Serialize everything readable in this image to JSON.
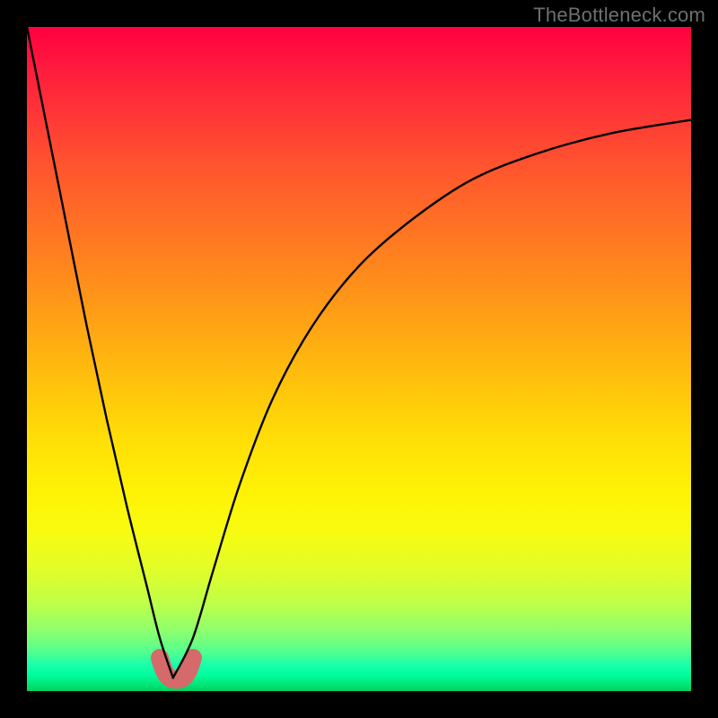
{
  "watermark": "TheBottleneck.com",
  "colors": {
    "frame": "#000000",
    "curve_main": "#000000",
    "curve_highlight": "#d46a6a",
    "gradient_top": "#ff0040",
    "gradient_mid": "#ffde07",
    "gradient_bottom": "#00d060"
  },
  "chart_data": {
    "type": "line",
    "title": "",
    "xlabel": "",
    "ylabel": "",
    "xlim": [
      0,
      100
    ],
    "ylim": [
      0,
      100
    ],
    "annotations": [],
    "note": "Two-branch curve: steep left branch falling from top-left to a minimum near x≈22, then a right branch rising with diminishing slope toward top-right. A short salmon-colored thick U-shaped segment sits at the minimum (roughly x 20–25, y≈2–5). Axis values and units are not labeled in the source image; x/y are normalized 0–100.",
    "series": [
      {
        "name": "left-branch",
        "x": [
          0,
          3,
          6,
          9,
          12,
          15,
          18,
          20,
          22
        ],
        "y": [
          100,
          85,
          70,
          55,
          41,
          28,
          16,
          8,
          2
        ]
      },
      {
        "name": "right-branch",
        "x": [
          22,
          25,
          28,
          32,
          37,
          43,
          50,
          58,
          67,
          77,
          88,
          100
        ],
        "y": [
          2,
          8,
          18,
          31,
          44,
          55,
          64,
          71,
          77,
          81,
          84,
          86
        ]
      },
      {
        "name": "highlight-u",
        "x": [
          20.0,
          20.7,
          21.5,
          22.5,
          23.5,
          24.3,
          25.0
        ],
        "y": [
          5.0,
          3.0,
          2.0,
          1.7,
          2.0,
          3.0,
          5.0
        ]
      }
    ]
  }
}
